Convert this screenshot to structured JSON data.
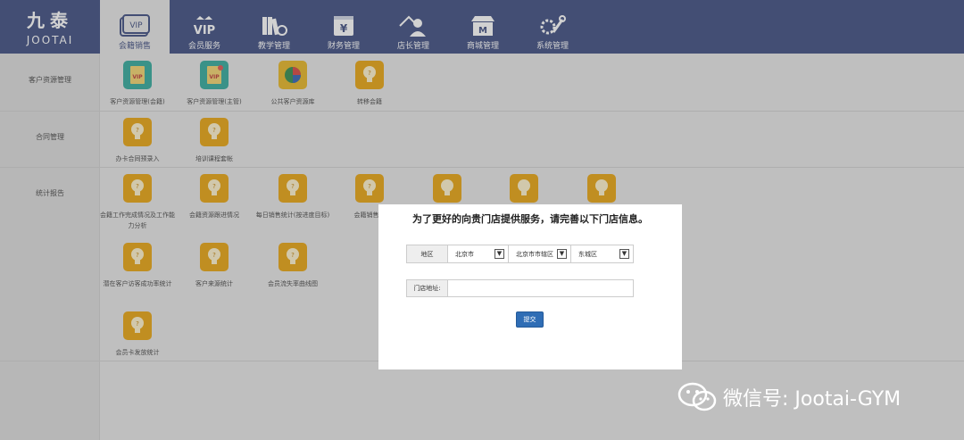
{
  "logo": {
    "cn": "九泰",
    "en": "JOOTAI"
  },
  "nav": [
    {
      "label": "会籍销售",
      "icon": "vip-card-icon",
      "active": true
    },
    {
      "label": "会员服务",
      "icon": "vip-crown-icon",
      "active": false
    },
    {
      "label": "教学管理",
      "icon": "books-icon",
      "active": false
    },
    {
      "label": "财务管理",
      "icon": "yuan-book-icon",
      "active": false
    },
    {
      "label": "店长管理",
      "icon": "manager-icon",
      "active": false
    },
    {
      "label": "商城管理",
      "icon": "shop-icon",
      "active": false
    },
    {
      "label": "系统管理",
      "icon": "tools-icon",
      "active": false
    }
  ],
  "sections": [
    {
      "label": "客户资源管理"
    },
    {
      "label": "合同管理"
    },
    {
      "label": "统计报告"
    }
  ],
  "tiles": {
    "customer": [
      "客户资源管理(会籍)",
      "客户资源管理(主管)",
      "公共客户资源库",
      "转移会籍"
    ],
    "contract": [
      "办卡合同预录入",
      "培训课程套帐"
    ],
    "stats_row1": [
      "会籍工作完成情况及工作能力分析",
      "会籍资源跟进情况",
      "每日销售统计(按进度目标)",
      "会籍销售工",
      "",
      "",
      ""
    ],
    "stats_row2": [
      "潜在客户访客成功率统计",
      "客户来源统计",
      "会员流失率曲线图"
    ],
    "stats_row3": [
      "会员卡发放统计"
    ]
  },
  "modal": {
    "title": "为了更好的向贵门店提供服务，请完善以下门店信息。",
    "region_label": "地区",
    "province": "北京市",
    "city": "北京市市辖区",
    "district": "东城区",
    "address_label": "门店地址:",
    "address_value": "",
    "submit_label": "提交"
  },
  "watermark": {
    "text": "微信号: Jootai-GYM",
    "icon": "wechat-icon"
  },
  "colors": {
    "nav_bg": "#3b4a7e",
    "tile_orange": "#e8a20c",
    "tile_teal": "#2fa89a",
    "submit_blue": "#2f6db5"
  }
}
